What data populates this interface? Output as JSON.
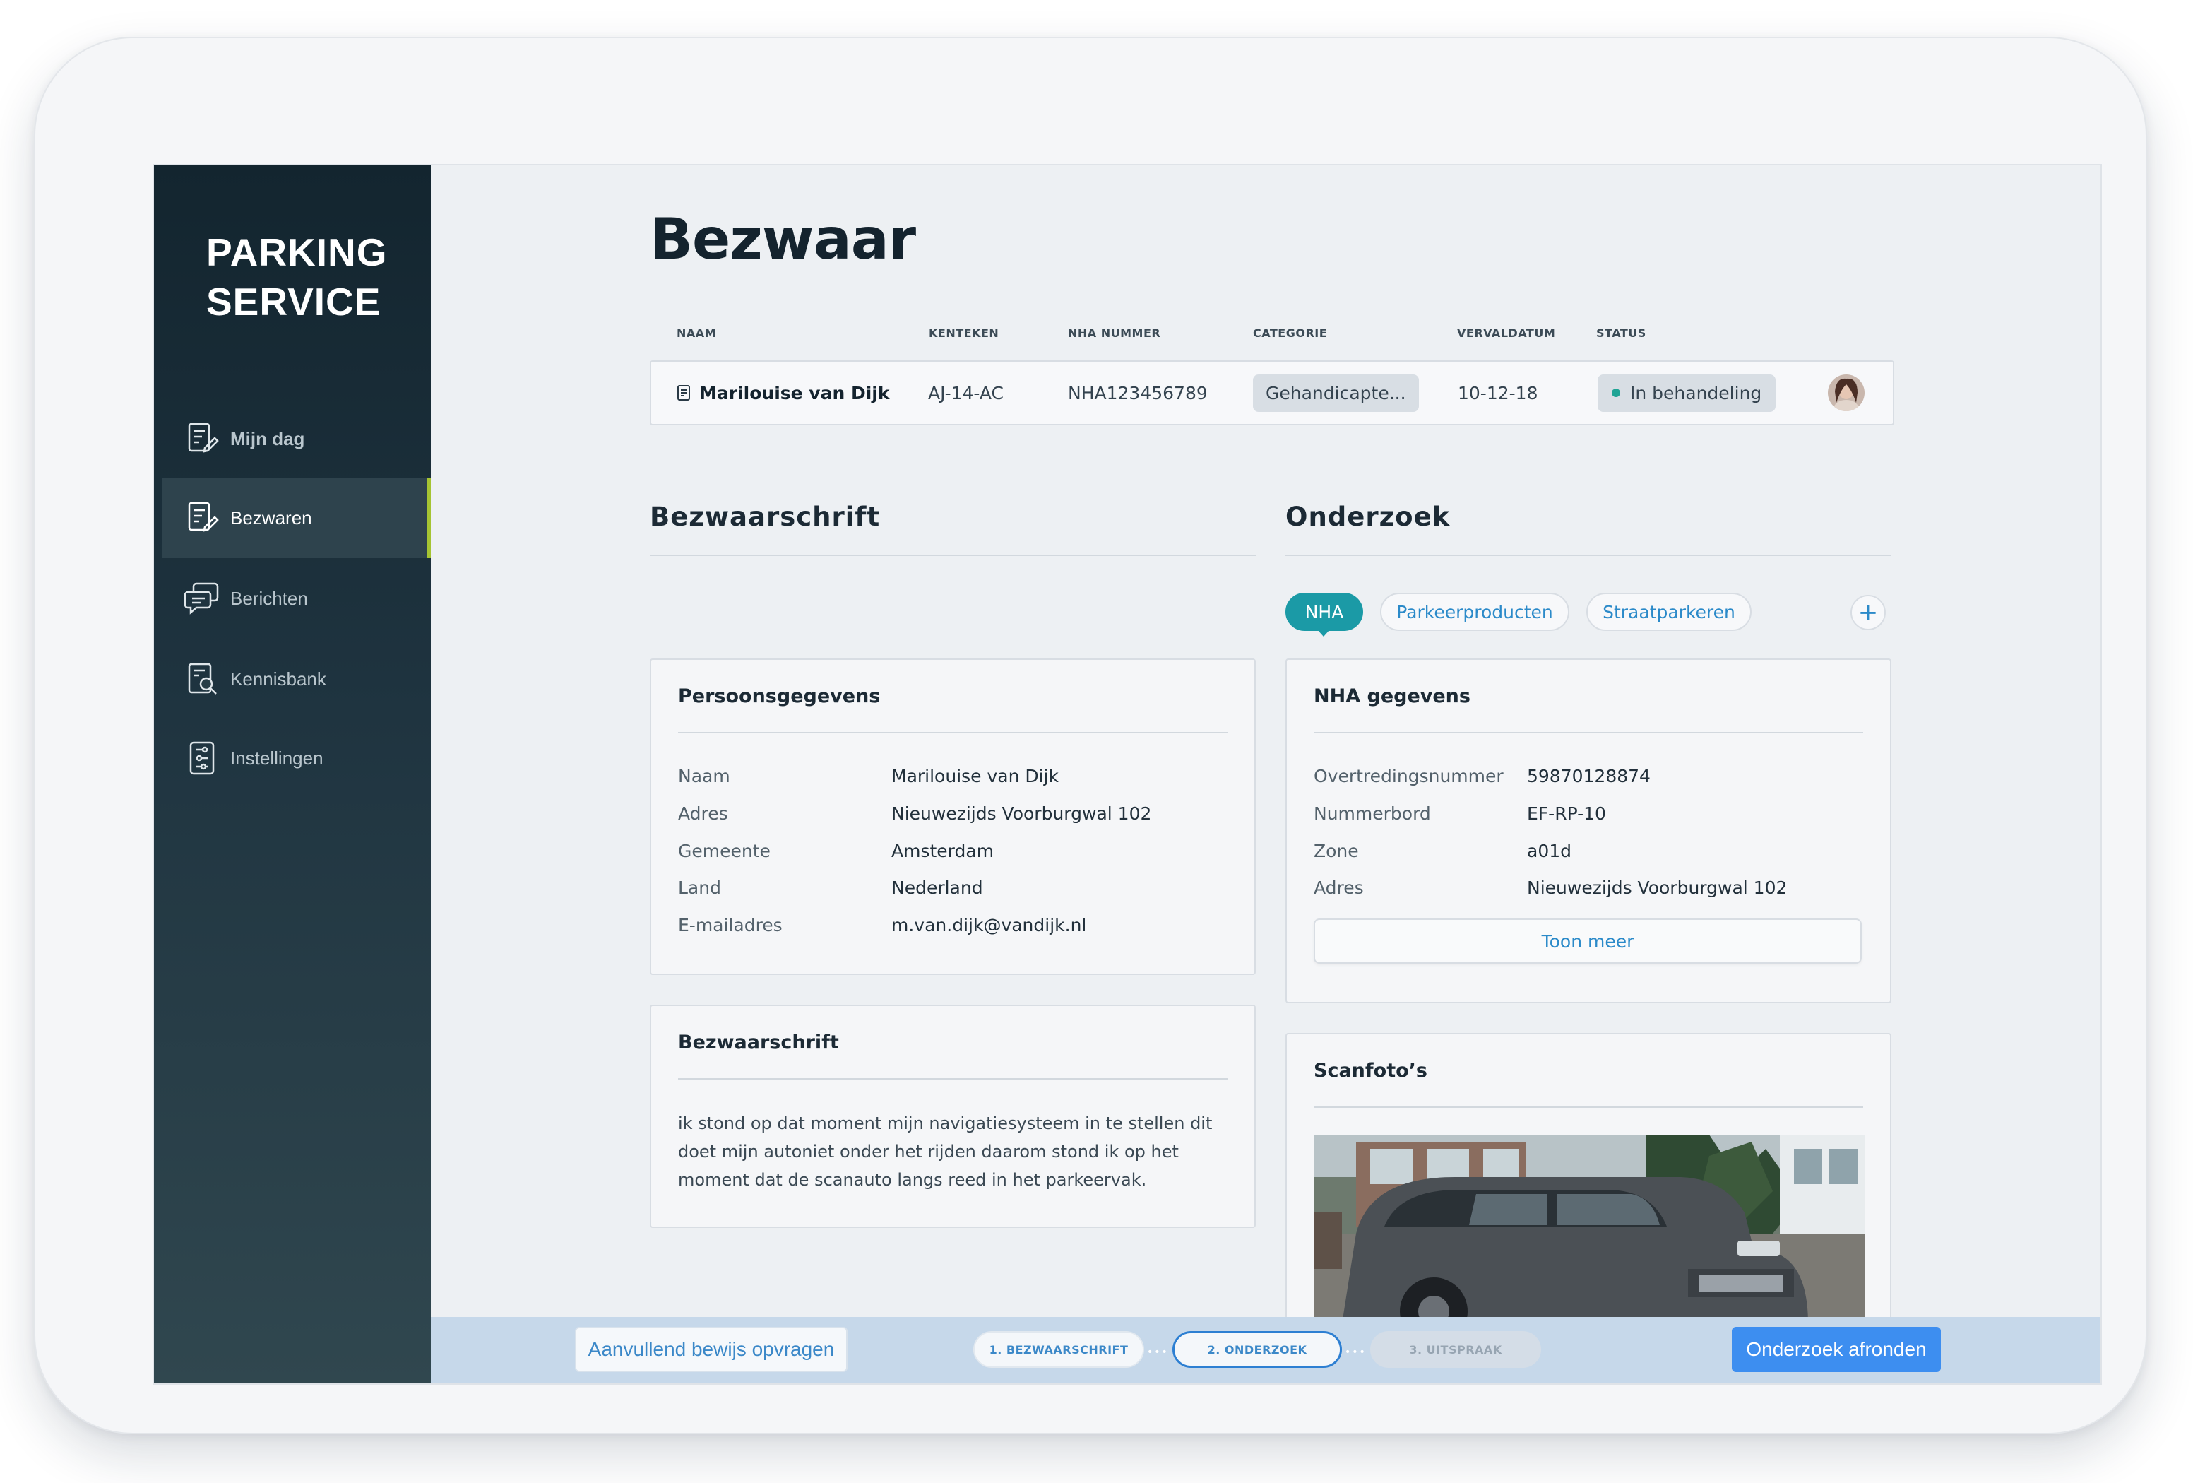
{
  "brand": {
    "line1": "PARKING",
    "line2": "SERVICE"
  },
  "nav": [
    {
      "label": "Mijn dag",
      "icon": "document-edit-icon",
      "active": false
    },
    {
      "label": "Bezwaren",
      "icon": "document-edit-icon",
      "active": true
    },
    {
      "label": "Berichten",
      "icon": "chat-icon",
      "active": false
    },
    {
      "label": "Kennisbank",
      "icon": "document-search-icon",
      "active": false
    },
    {
      "label": "Instellingen",
      "icon": "sliders-icon",
      "active": false
    }
  ],
  "page": {
    "title": "Bezwaar"
  },
  "table": {
    "headers": [
      "NAAM",
      "KENTEKEN",
      "NHA NUMMER",
      "CATEGORIE",
      "VERVALDATUM",
      "STATUS"
    ],
    "row": {
      "naam": "Marilouise van Dijk",
      "kenteken": "AJ-14-AC",
      "nha_nummer": "NHA123456789",
      "categorie": "Gehandicapte...",
      "vervaldatum": "10-12-18",
      "status": "In behandeling",
      "status_color": "#1ea394"
    }
  },
  "sections": {
    "left": "Bezwaarschrift",
    "right": "Onderzoek"
  },
  "tabs": [
    {
      "label": "NHA",
      "active": true
    },
    {
      "label": "Parkeerproducten",
      "active": false
    },
    {
      "label": "Straatparkeren",
      "active": false
    }
  ],
  "add_tab": "+",
  "persoonsgegevens": {
    "title": "Persoonsgegevens",
    "rows": [
      {
        "label": "Naam",
        "value": "Marilouise van Dijk"
      },
      {
        "label": "Adres",
        "value": "Nieuwezijds Voorburgwal 102"
      },
      {
        "label": "Gemeente",
        "value": "Amsterdam"
      },
      {
        "label": "Land",
        "value": "Nederland"
      },
      {
        "label": "E-mailadres",
        "value": "m.van.dijk@vandijk.nl"
      }
    ]
  },
  "bezwaarschrift": {
    "title": "Bezwaarschrift",
    "text": "ik stond op dat moment mijn navigatiesysteem in te stellen dit doet mijn autoniet onder het rijden daarom stond ik op het moment dat de scanauto langs reed in het parkeervak."
  },
  "nha_gegevens": {
    "title": "NHA gegevens",
    "rows": [
      {
        "label": "Overtredingsnummer",
        "value": "59870128874"
      },
      {
        "label": "Nummerbord",
        "value": "EF-RP-10"
      },
      {
        "label": "Zone",
        "value": "a01d"
      },
      {
        "label": "Adres",
        "value": "Nieuwezijds Voorburgwal 102"
      }
    ],
    "more_label": "Toon meer"
  },
  "scanfotos": {
    "title": "Scanfoto’s"
  },
  "bottom": {
    "secondary_action": "Aanvullend bewijs opvragen",
    "steps": [
      {
        "label": "1. BEZWAARSCHRIFT",
        "state": "done"
      },
      {
        "label": "2. ONDERZOEK",
        "state": "current"
      },
      {
        "label": "3. UITSPRAAK",
        "state": "todo"
      }
    ],
    "primary_action": "Onderzoek afronden"
  },
  "colors": {
    "accent": "#1b9aa6",
    "link": "#2b8ac9",
    "primary_button": "#3d8ef0",
    "nav_active_marker": "#a5c432"
  }
}
